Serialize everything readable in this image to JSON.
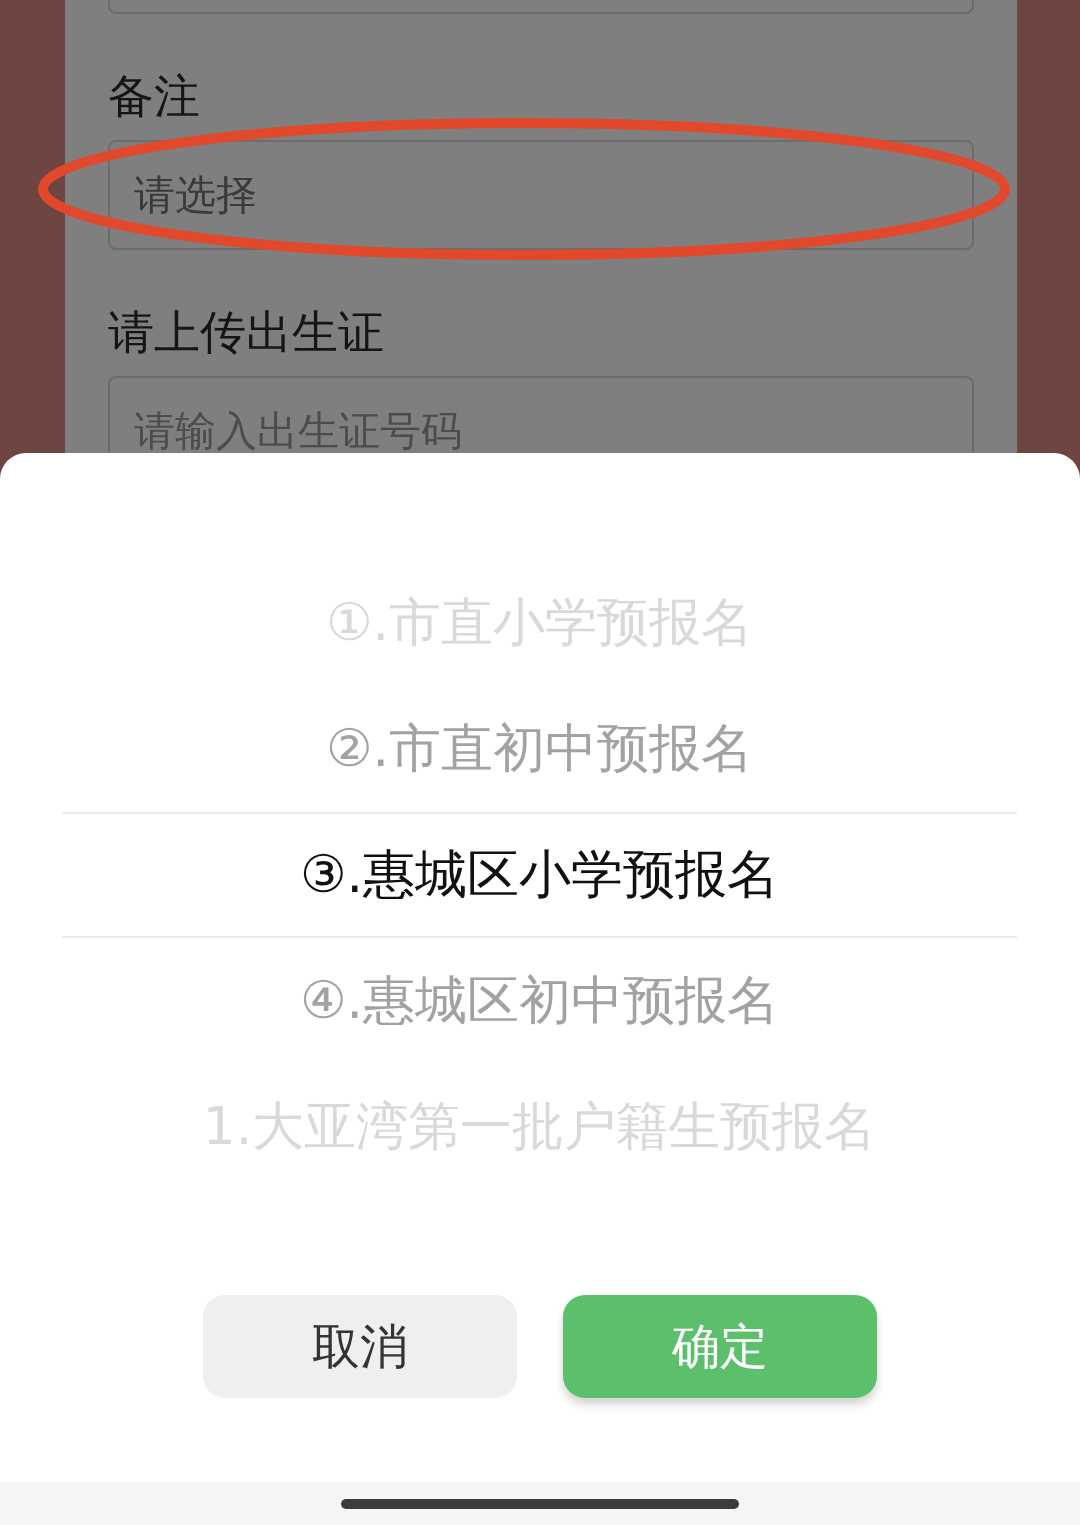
{
  "form": {
    "fields": [
      {
        "kind": "stub",
        "circled": false
      },
      {
        "kind": "select",
        "label": "备注",
        "placeholder": "请选择",
        "circled": true
      },
      {
        "kind": "input",
        "label": "请上传出生证",
        "placeholder": "请输入出生证号码",
        "circled": false
      }
    ]
  },
  "picker": {
    "options": [
      {
        "label": "①.市直小学预报名",
        "selected": false
      },
      {
        "label": "②.市直初中预报名",
        "selected": false
      },
      {
        "label": "③.惠城区小学预报名",
        "selected": true
      },
      {
        "label": "④.惠城区初中预报名",
        "selected": false
      },
      {
        "label": "1.大亚湾第一批户籍生预报名",
        "selected": false
      }
    ]
  },
  "buttons": [
    {
      "kind": "cancel",
      "label": "取消"
    },
    {
      "kind": "confirm",
      "label": "确定"
    }
  ]
}
